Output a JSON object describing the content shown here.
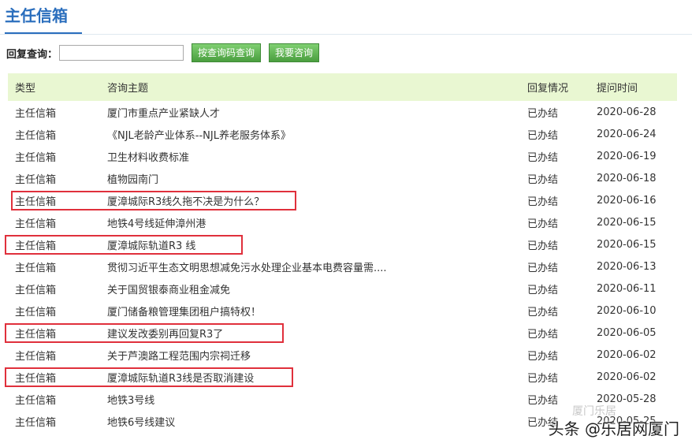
{
  "header": {
    "title": "主任信箱"
  },
  "search": {
    "label": "回复查询：",
    "input_value": "",
    "query_button": "按查询码查询",
    "consult_button": "我要咨询"
  },
  "table": {
    "columns": [
      "类型",
      "咨询主题",
      "回复情况",
      "提问时间"
    ],
    "rows": [
      {
        "type": "主任信箱",
        "subject": "厦门市重点产业紧缺人才",
        "status": "已办结",
        "date": "2020-06-28"
      },
      {
        "type": "主任信箱",
        "subject": "《NJL老龄产业体系--NJL养老服务体系》",
        "status": "已办结",
        "date": "2020-06-24"
      },
      {
        "type": "主任信箱",
        "subject": "卫生材料收费标准",
        "status": "已办结",
        "date": "2020-06-19"
      },
      {
        "type": "主任信箱",
        "subject": "植物园南门",
        "status": "已办结",
        "date": "2020-06-18"
      },
      {
        "type": "主任信箱",
        "subject": "厦漳城际R3线久拖不决是为什么？",
        "status": "已办结",
        "date": "2020-06-16"
      },
      {
        "type": "主任信箱",
        "subject": "地铁4号线延伸漳州港",
        "status": "已办结",
        "date": "2020-06-15"
      },
      {
        "type": "主任信箱",
        "subject": "厦漳城际轨道R3 线",
        "status": "已办结",
        "date": "2020-06-15"
      },
      {
        "type": "主任信箱",
        "subject": "贯彻习近平生态文明思想减免污水处理企业基本电费容量需....",
        "status": "已办结",
        "date": "2020-06-13"
      },
      {
        "type": "主任信箱",
        "subject": "关于国贸银泰商业租金减免",
        "status": "已办结",
        "date": "2020-06-11"
      },
      {
        "type": "主任信箱",
        "subject": "厦门储备粮管理集团租户搞特权！",
        "status": "已办结",
        "date": "2020-06-10"
      },
      {
        "type": "主任信箱",
        "subject": "建议发改委别再回复R3了",
        "status": "已办结",
        "date": "2020-06-05"
      },
      {
        "type": "主任信箱",
        "subject": "关于芦澳路工程范围内宗祠迁移",
        "status": "已办结",
        "date": "2020-06-02"
      },
      {
        "type": "主任信箱",
        "subject": "厦漳城际轨道R3线是否取消建设",
        "status": "已办结",
        "date": "2020-06-02"
      },
      {
        "type": "主任信箱",
        "subject": "地铁3号线",
        "status": "已办结",
        "date": "2020-05-28"
      },
      {
        "type": "主任信箱",
        "subject": "地铁6号线建议",
        "status": "已办结",
        "date": "2020-05-25"
      }
    ]
  },
  "highlight_color": "#e0303c",
  "watermark": {
    "text": "头条 @乐居网厦门",
    "logo_text": "厦门乐居"
  }
}
